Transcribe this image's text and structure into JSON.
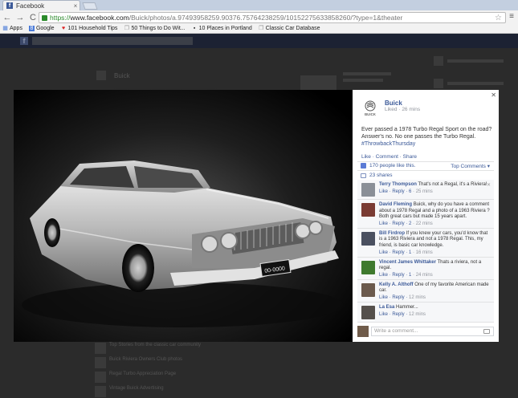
{
  "browser": {
    "tab_title": "Facebook",
    "tab_close": "×",
    "url_https": "https://",
    "url_host": "www.facebook.com",
    "url_path": "/Buick/photos/a.97493958259.90376.75764238259/10152275633858260/?type=1&theater",
    "bookmarks": [
      {
        "label": "Apps",
        "icon": "apps-icon"
      },
      {
        "label": "Google",
        "icon": "google-icon"
      },
      {
        "label": "101 Household Tips",
        "icon": "heart-icon"
      },
      {
        "label": "50 Things to Do Wit...",
        "icon": "page-icon"
      },
      {
        "label": "10 Places in Portland",
        "icon": "page-icon"
      },
      {
        "label": "Classic Car Database",
        "icon": "page-icon"
      }
    ]
  },
  "post": {
    "page_name": "Buick",
    "logo_text": "BUICK",
    "meta": "Liked · 26 mins",
    "text": "Ever passed a 1978 Turbo Regal Sport on the road? Answer's no. No one passes the Turbo Regal.",
    "hashtag": "#ThrowbackThursday",
    "actions": "Like · Comment · Share",
    "likes": "170 people like this.",
    "top_comments": "Top Comments ▾",
    "shares": "23 shares",
    "plate": "00-0000"
  },
  "comments": [
    {
      "author": "Terry Thompson",
      "text": "That's not a Regal, it's a Riviera!",
      "foot": "Like · Reply · ",
      "likes": "6",
      "time": " · 25 mins",
      "avatar_color": "#8a8f97"
    },
    {
      "author": "David Fleming",
      "text": "Buick, why do you have a comment about a 1978 Regal and a photo of a 1963 Riviera ? Both great cars but made 15 years apart.",
      "foot": "Like · Reply · ",
      "likes": "2",
      "time": " · 22 mins",
      "avatar_color": "#7a3b33"
    },
    {
      "author": "Bill Firdrop",
      "text": "If you knew your cars, you'd know that is a 1963 Riviera and not a 1978 Regal. This, my friend, is basic car knowledge.",
      "foot": "Like · Reply · ",
      "likes": "1",
      "time": " · 16 mins",
      "avatar_color": "#4a5060"
    },
    {
      "author": "Vincent James Whittaker",
      "text": "Thats a riviera, not a regal.",
      "foot": "Like · Reply · ",
      "likes": "1",
      "time": " · 24 mins",
      "avatar_color": "#3f7a2e"
    },
    {
      "author": "Kelly A. Althoff",
      "text": "One of my favorite American made car.",
      "foot": "Like · Reply · ",
      "likes": "",
      "time": "12 mins",
      "avatar_color": "#6b5a4d"
    },
    {
      "author": "La Esa",
      "text": "Hammer...",
      "foot": "Like · Reply · ",
      "likes": "",
      "time": "12 mins",
      "avatar_color": "#55504c"
    }
  ],
  "write_placeholder": "Write a comment...",
  "background_page": {
    "left_snippet": "Buick",
    "bottom_items": [
      "Top Stories from the classic car community",
      "Buick Riviera Owners Club photos",
      "Regal Turbo Appreciation Page",
      "Vintage Buick Advertising"
    ]
  }
}
